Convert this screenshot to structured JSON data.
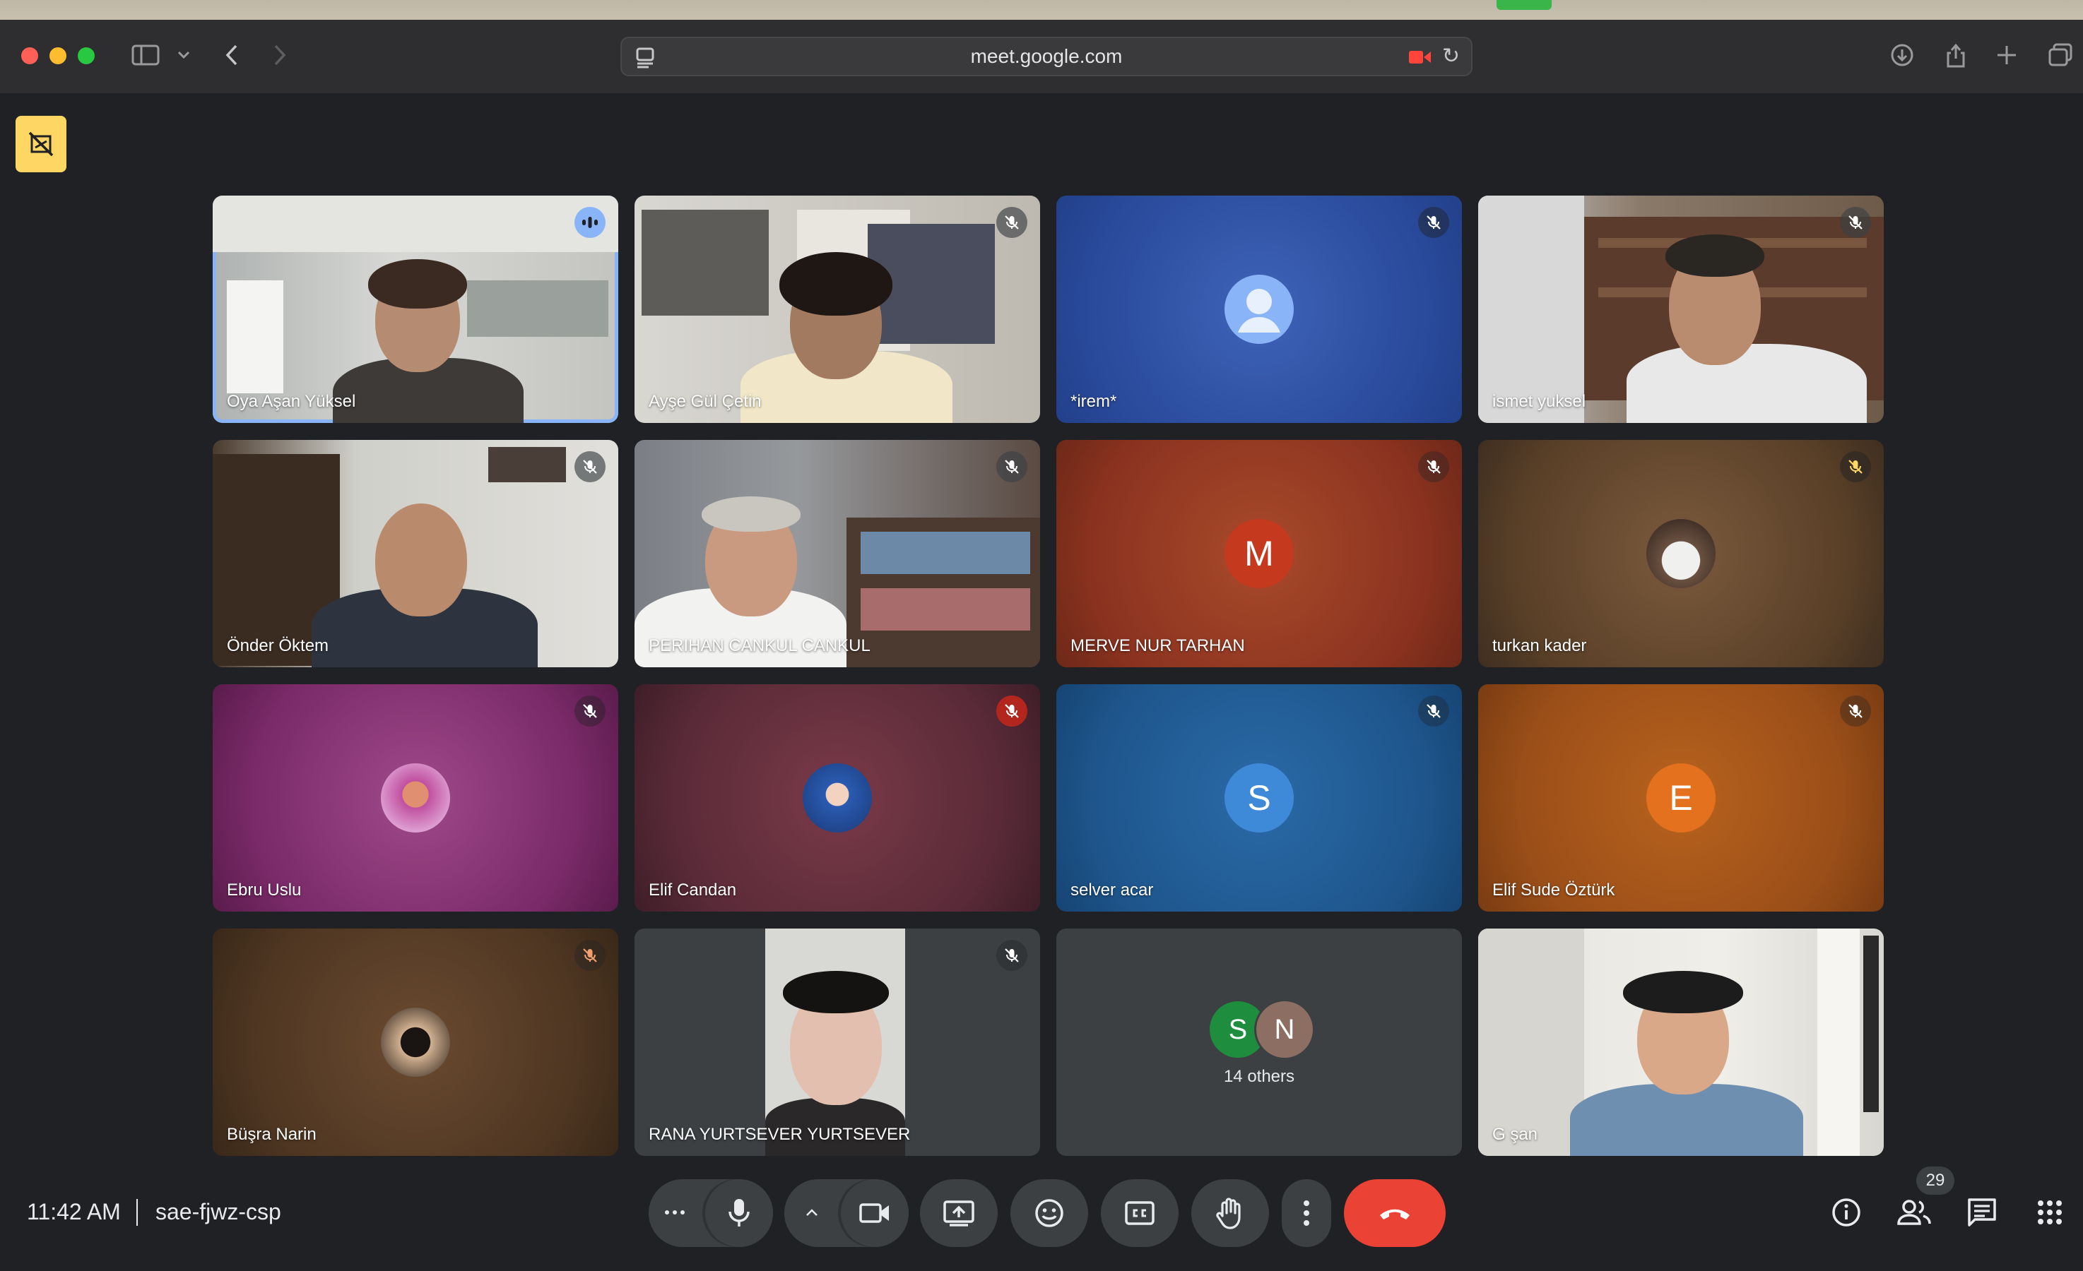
{
  "browser": {
    "url": "meet.google.com"
  },
  "participants": [
    {
      "name": "Oya Aşan Yüksel",
      "speaking": true,
      "muted": false
    },
    {
      "name": "Ayşe Gül Çetin",
      "muted": true
    },
    {
      "name": "*irem*",
      "muted": true
    },
    {
      "name": "ismet yuksel",
      "muted": true
    },
    {
      "name": "Önder Öktem",
      "muted": true
    },
    {
      "name": "PERIHAN CANKUL CANKUL",
      "muted": true
    },
    {
      "name": "MERVE NUR TARHAN",
      "muted": true,
      "initial": "M"
    },
    {
      "name": "turkan kader",
      "muted": true
    },
    {
      "name": "Ebru Uslu",
      "muted": true
    },
    {
      "name": "Elif Candan",
      "muted": true
    },
    {
      "name": "selver acar",
      "muted": true,
      "initial": "S"
    },
    {
      "name": "Elif Sude Öztürk",
      "muted": true,
      "initial": "E"
    },
    {
      "name": "Büşra Narin",
      "muted": true
    },
    {
      "name": "RANA YURTSEVER YURTSEVER",
      "muted": true
    },
    {
      "name": "G şan",
      "muted": false
    }
  ],
  "others": {
    "initials": [
      "S",
      "N"
    ],
    "label": "14 others"
  },
  "meeting": {
    "time": "11:42 AM",
    "code": "sae-fjwz-csp",
    "participant_count": "29"
  },
  "colors": {
    "accent": "#8ab4f8",
    "end_call": "#ea4335",
    "pin": "#fdd663"
  }
}
